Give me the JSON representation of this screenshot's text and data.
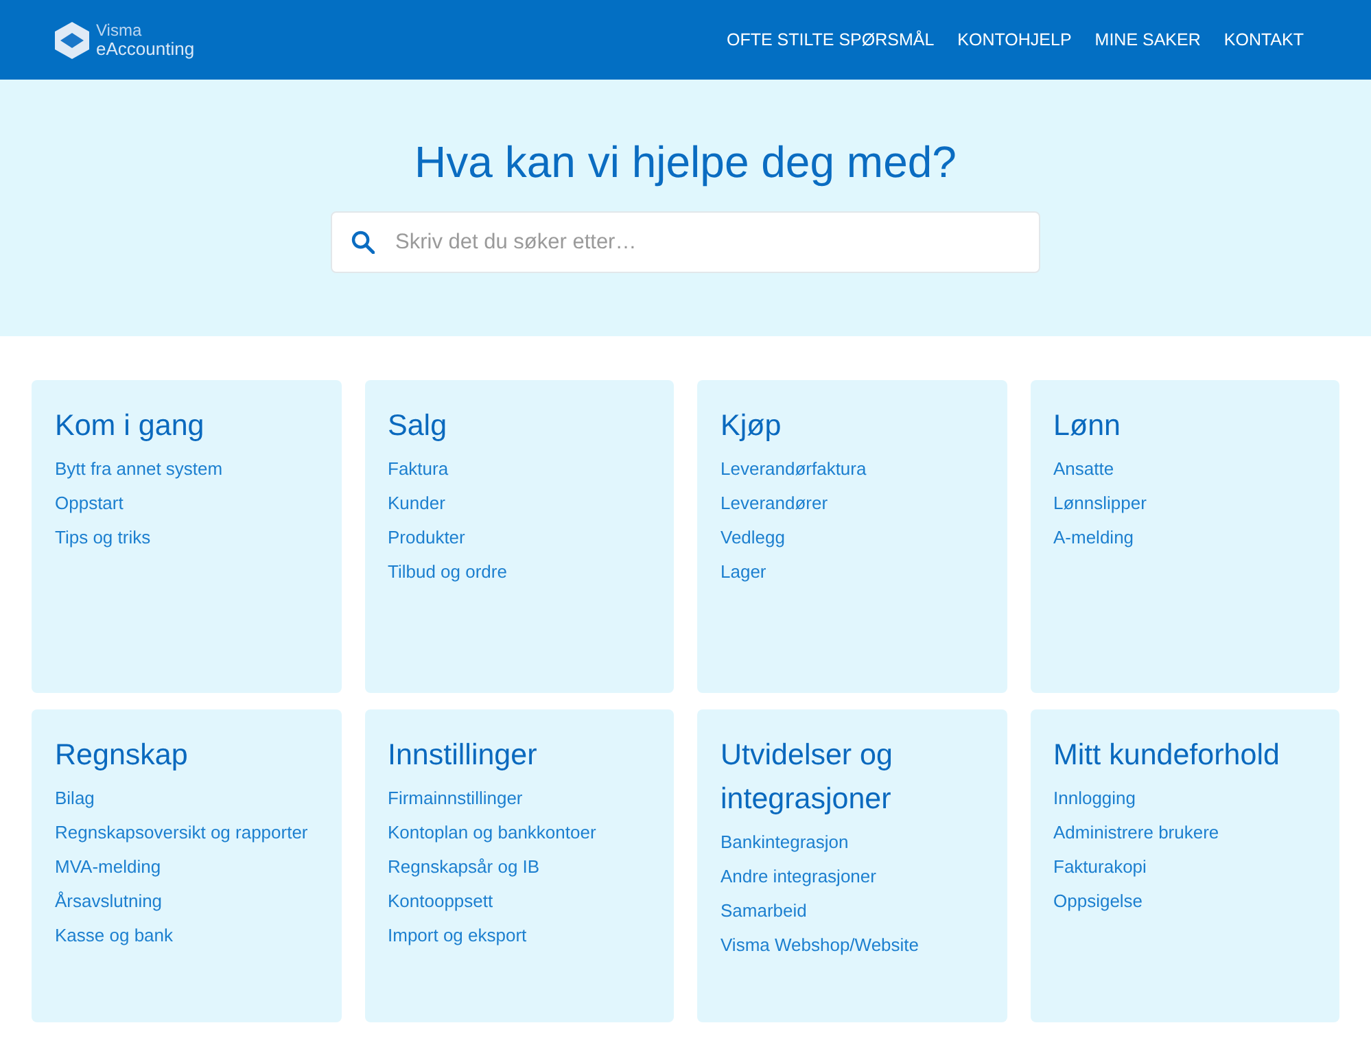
{
  "header": {
    "logo": {
      "brand": "Visma",
      "product": "eAccounting"
    },
    "nav": [
      "OFTE STILTE SPØRSMÅL",
      "KONTOHJELP",
      "MINE SAKER",
      "KONTAKT"
    ]
  },
  "hero": {
    "title": "Hva kan vi hjelpe deg med?",
    "search": {
      "placeholder": "Skriv det du søker etter…"
    }
  },
  "categories": [
    {
      "title": "Kom i gang",
      "links": [
        "Bytt fra annet system",
        "Oppstart",
        "Tips og triks"
      ]
    },
    {
      "title": "Salg",
      "links": [
        "Faktura",
        "Kunder",
        "Produkter",
        "Tilbud og ordre"
      ]
    },
    {
      "title": "Kjøp",
      "links": [
        "Leverandørfaktura",
        "Leverandører",
        "Vedlegg",
        "Lager"
      ]
    },
    {
      "title": "Lønn",
      "links": [
        "Ansatte",
        "Lønnslipper",
        "A-melding"
      ]
    },
    {
      "title": "Regnskap",
      "links": [
        "Bilag",
        "Regnskapsoversikt og rapporter",
        "MVA-melding",
        "Årsavslutning",
        "Kasse og bank"
      ]
    },
    {
      "title": "Innstillinger",
      "links": [
        "Firmainnstillinger",
        "Kontoplan og bankkontoer",
        "Regnskapsår og IB",
        "Kontooppsett",
        "Import og eksport"
      ]
    },
    {
      "title": "Utvidelser og integrasjoner",
      "links": [
        "Bankintegrasjon",
        "Andre integrasjoner",
        "Samarbeid",
        "Visma Webshop/Website"
      ]
    },
    {
      "title": "Mitt kundeforhold",
      "links": [
        "Innlogging",
        "Administrere brukere",
        "Fakturakopi",
        "Oppsigelse"
      ]
    }
  ]
}
